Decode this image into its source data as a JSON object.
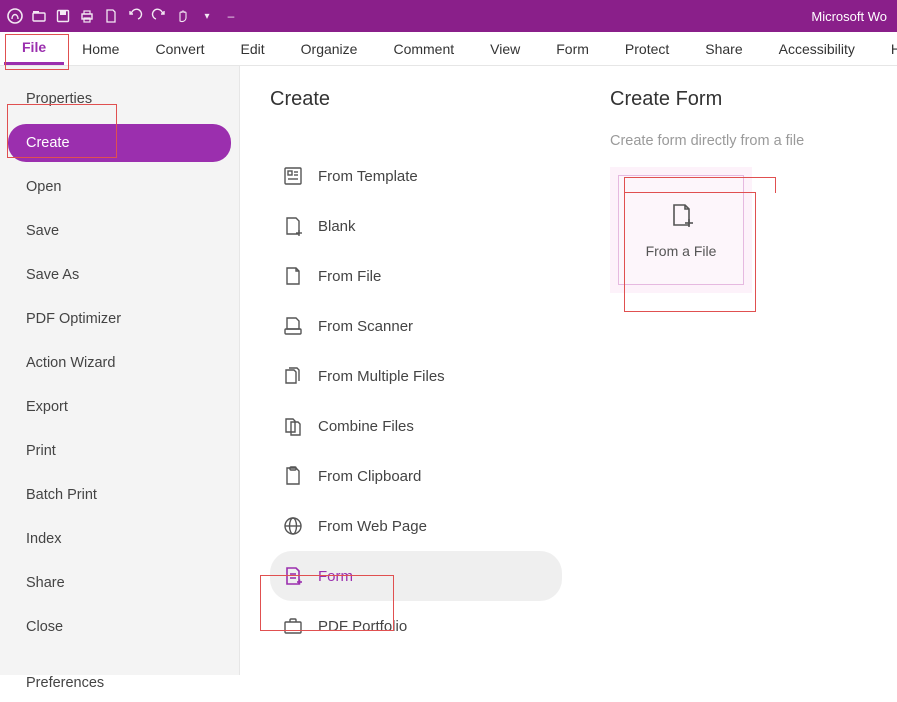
{
  "titlebar": {
    "doc_title": "Microsoft Wo"
  },
  "ribbon": {
    "tabs": [
      {
        "label": "File",
        "active": true
      },
      {
        "label": "Home"
      },
      {
        "label": "Convert"
      },
      {
        "label": "Edit"
      },
      {
        "label": "Organize"
      },
      {
        "label": "Comment"
      },
      {
        "label": "View"
      },
      {
        "label": "Form"
      },
      {
        "label": "Protect"
      },
      {
        "label": "Share"
      },
      {
        "label": "Accessibility"
      },
      {
        "label": "H"
      }
    ]
  },
  "sidebar": {
    "items": [
      {
        "label": "Properties"
      },
      {
        "label": "Create",
        "active": true
      },
      {
        "label": "Open"
      },
      {
        "label": "Save"
      },
      {
        "label": "Save As"
      },
      {
        "label": "PDF Optimizer"
      },
      {
        "label": "Action Wizard"
      },
      {
        "label": "Export"
      },
      {
        "label": "Print"
      },
      {
        "label": "Batch Print"
      },
      {
        "label": "Index"
      },
      {
        "label": "Share"
      },
      {
        "label": "Close"
      },
      {
        "label": "Preferences",
        "separated": true
      }
    ]
  },
  "center": {
    "title": "Create",
    "items": [
      {
        "label": "From Template",
        "icon": "template-icon"
      },
      {
        "label": "Blank",
        "icon": "blank-icon"
      },
      {
        "label": "From File",
        "icon": "file-icon"
      },
      {
        "label": "From Scanner",
        "icon": "scanner-icon"
      },
      {
        "label": "From Multiple Files",
        "icon": "multi-file-icon"
      },
      {
        "label": "Combine Files",
        "icon": "combine-icon"
      },
      {
        "label": "From Clipboard",
        "icon": "clipboard-icon"
      },
      {
        "label": "From Web Page",
        "icon": "web-icon"
      },
      {
        "label": "Form",
        "icon": "form-icon",
        "selected": true
      },
      {
        "label": "PDF Portfolio",
        "icon": "portfolio-icon"
      }
    ]
  },
  "right": {
    "title": "Create Form",
    "subtitle": "Create form directly from a file",
    "tile_label": "From a File"
  }
}
